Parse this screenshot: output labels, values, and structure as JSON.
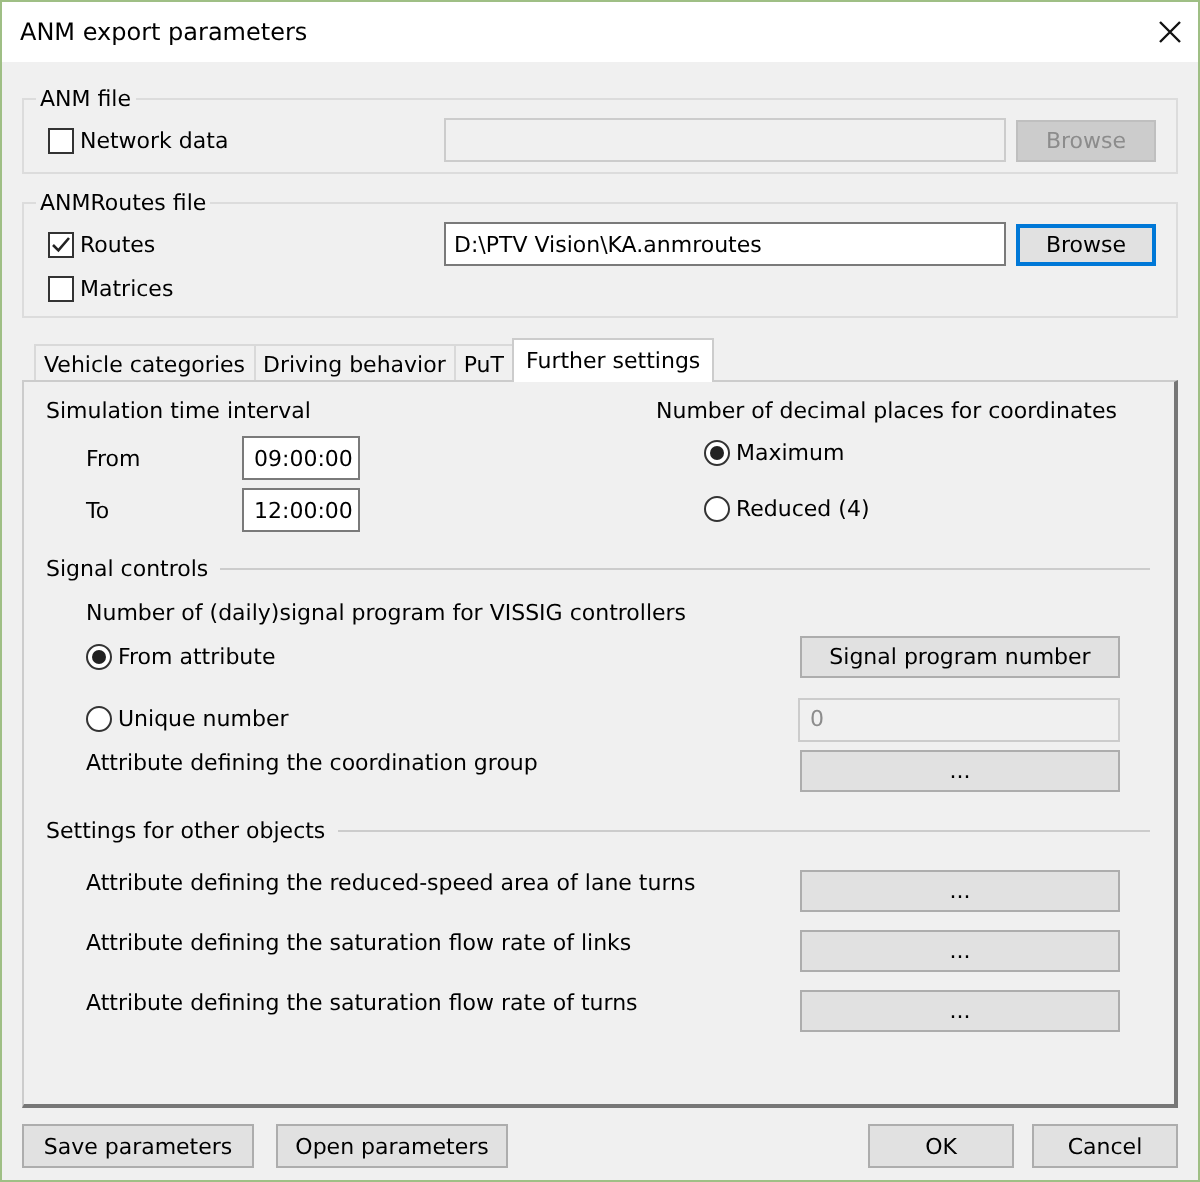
{
  "window": {
    "title": "ANM export parameters"
  },
  "anm_file": {
    "legend": "ANM file",
    "checkbox": {
      "label": "Network data",
      "checked": false
    },
    "path": {
      "disabled": true
    },
    "browse": {
      "label": "Browse",
      "disabled": true,
      "focused": false
    }
  },
  "anmroutes_file": {
    "legend": "ANMRoutes file",
    "checkboxes": [
      {
        "label": "Routes",
        "checked": true
      },
      {
        "label": "Matrices",
        "checked": false
      }
    ],
    "path": {
      "value": "D:\\PTV Vision\\KA.anmroutes",
      "disabled": false
    },
    "browse": {
      "label": "Browse",
      "disabled": false,
      "focused": true
    }
  },
  "tabs": [
    {
      "label": "Vehicle categories",
      "selected": false
    },
    {
      "label": "Driving behavior",
      "selected": false
    },
    {
      "label": "PuT",
      "selected": false
    },
    {
      "label": "Further settings",
      "selected": true
    }
  ],
  "further_settings": {
    "time_interval": {
      "title": "Simulation time interval",
      "fields": [
        {
          "label": "From",
          "value": "09:00:00"
        },
        {
          "label": "To",
          "value": "12:00:00"
        }
      ]
    },
    "decimal_places": {
      "title": "Number of decimal places for coordinates",
      "options": [
        {
          "label": "Maximum",
          "selected": true
        },
        {
          "label": "Reduced (4)",
          "selected": false
        }
      ]
    },
    "signal_controls": {
      "title": "Signal controls",
      "subtitle": "Number of (daily)signal program for VISSIG controllers",
      "options": [
        {
          "label": "From attribute",
          "selected": true,
          "button": "Signal program number"
        },
        {
          "label": "Unique number",
          "selected": false,
          "field": {
            "value": "0",
            "disabled": true
          }
        }
      ],
      "coordination": {
        "label": "Attribute defining the coordination group",
        "button": "..."
      }
    },
    "other_objects": {
      "title": "Settings for other objects",
      "rows": [
        {
          "label": "Attribute defining the reduced-speed area of lane turns",
          "button": "..."
        },
        {
          "label": "Attribute defining the saturation flow rate of links",
          "button": "..."
        },
        {
          "label": "Attribute defining the saturation flow rate of turns",
          "button": "..."
        }
      ]
    }
  },
  "footer": {
    "left": [
      "Save parameters",
      "Open parameters"
    ],
    "right": [
      "OK",
      "Cancel"
    ]
  }
}
